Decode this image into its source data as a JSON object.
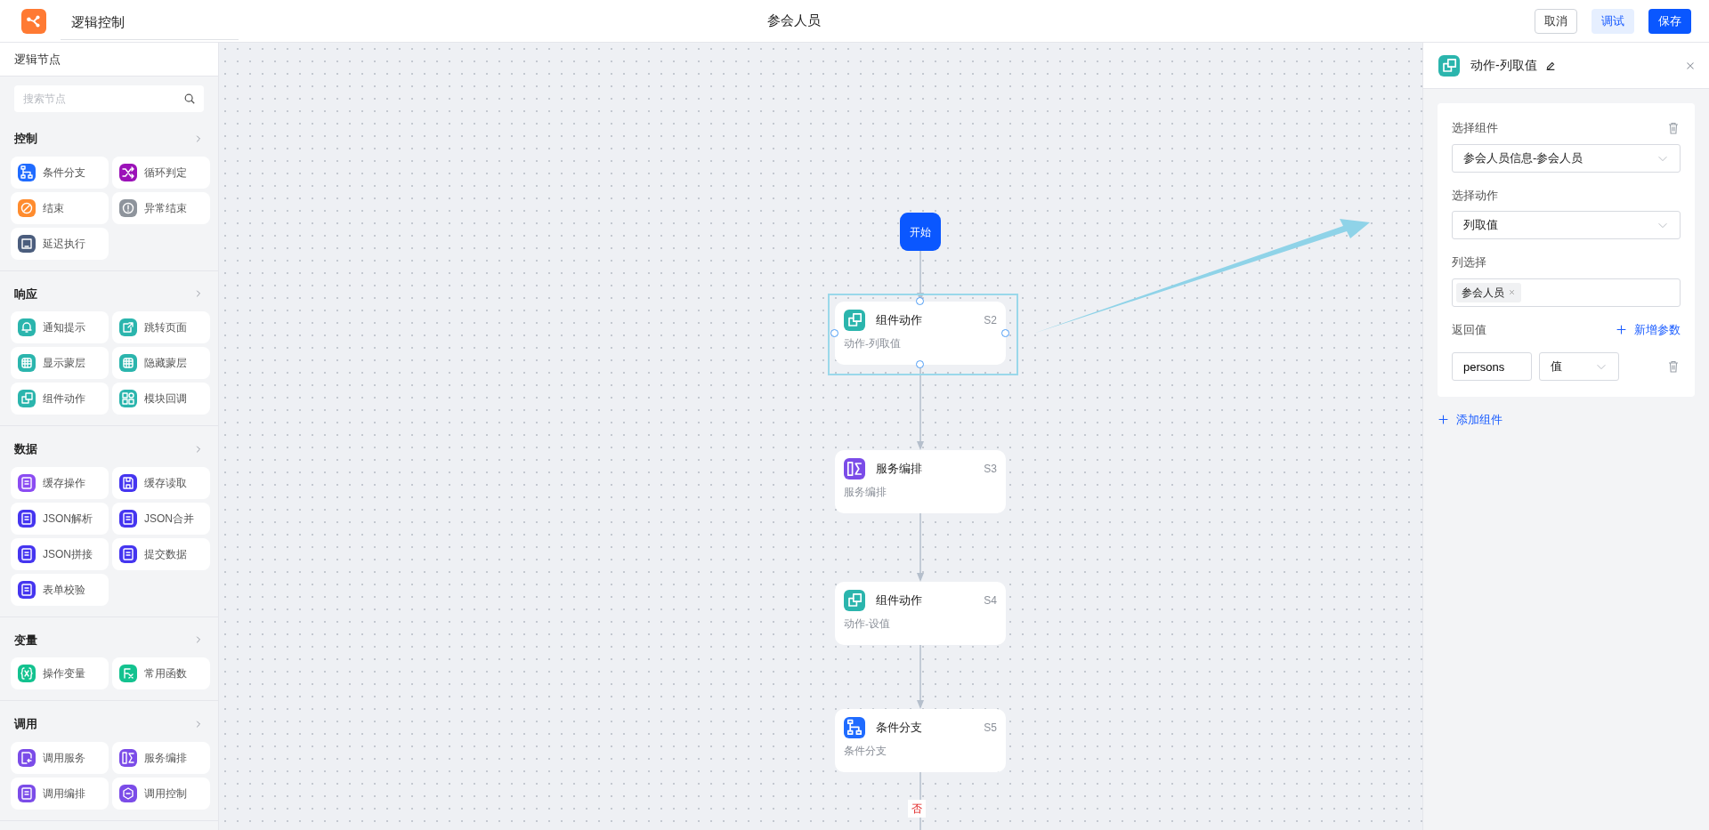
{
  "app": {
    "title": "逻辑控制",
    "page_title": "参会人员",
    "buttons": [
      {
        "label": "取消",
        "kind": "default"
      },
      {
        "label": "调试",
        "kind": "light"
      },
      {
        "label": "保存",
        "kind": "primary"
      }
    ]
  },
  "sidebar": {
    "title": "逻辑节点",
    "search": {
      "placeholder": "搜索节点"
    },
    "groups": [
      {
        "title": "控制",
        "items": [
          {
            "label": "条件分支",
            "color": "#1f6bff"
          },
          {
            "label": "循环判定",
            "color": "#9b12b8"
          },
          {
            "label": "结束",
            "color": "#ff8c2e"
          },
          {
            "label": "异常结束",
            "color": "#8e949c"
          },
          {
            "label": "延迟执行",
            "color": "#4b5d7d"
          }
        ]
      },
      {
        "title": "响应",
        "items": [
          {
            "label": "通知提示",
            "color": "#2bb5ad"
          },
          {
            "label": "跳转页面",
            "color": "#2bb5ad"
          },
          {
            "label": "显示蒙层",
            "color": "#2bb5ad"
          },
          {
            "label": "隐藏蒙层",
            "color": "#2bb5ad"
          },
          {
            "label": "组件动作",
            "color": "#2bb5ad"
          },
          {
            "label": "模块回调",
            "color": "#2bb5ad"
          }
        ]
      },
      {
        "title": "数据",
        "items": [
          {
            "label": "缓存操作",
            "color": "#8b4cf2"
          },
          {
            "label": "缓存读取",
            "color": "#4535f0"
          },
          {
            "label": "JSON解析",
            "color": "#4535f0"
          },
          {
            "label": "JSON合并",
            "color": "#4535f0"
          },
          {
            "label": "JSON拼接",
            "color": "#4535f0"
          },
          {
            "label": "提交数据",
            "color": "#4535f0"
          },
          {
            "label": "表单校验",
            "color": "#4535f0"
          }
        ]
      },
      {
        "title": "变量",
        "items": [
          {
            "label": "操作变量",
            "color": "#13c28f"
          },
          {
            "label": "常用函数",
            "color": "#13c28f"
          }
        ]
      },
      {
        "title": "调用",
        "items": [
          {
            "label": "调用服务",
            "color": "#7b4ce8"
          },
          {
            "label": "服务编排",
            "color": "#7b4ce8"
          },
          {
            "label": "调用编排",
            "color": "#7b4ce8"
          },
          {
            "label": "调用控制",
            "color": "#7b4ce8"
          }
        ]
      }
    ]
  },
  "canvas": {
    "start": {
      "label": "开始"
    },
    "nodes": [
      {
        "kind": "component",
        "title": "组件动作",
        "step": "S2",
        "subtitle": "动作-列取值",
        "selected": true
      },
      {
        "kind": "service",
        "title": "服务编排",
        "step": "S3",
        "subtitle": "服务编排",
        "selected": false
      },
      {
        "kind": "component",
        "title": "组件动作",
        "step": "S4",
        "subtitle": "动作-设值",
        "selected": false
      },
      {
        "kind": "branch",
        "title": "条件分支",
        "step": "S5",
        "subtitle": "条件分支",
        "selected": false
      }
    ],
    "branch_label": "否"
  },
  "panel": {
    "title": "动作-列取值",
    "component": {
      "label": "选择组件",
      "value": "参会人员信息-参会人员"
    },
    "action": {
      "label": "选择动作",
      "value": "列取值"
    },
    "columns": {
      "label": "列选择",
      "tags": [
        "参会人员"
      ]
    },
    "returns": {
      "label": "返回值",
      "add_label": "新增参数",
      "rows": [
        {
          "name": "persons",
          "type": "值"
        }
      ]
    },
    "add_component": "添加组件"
  }
}
